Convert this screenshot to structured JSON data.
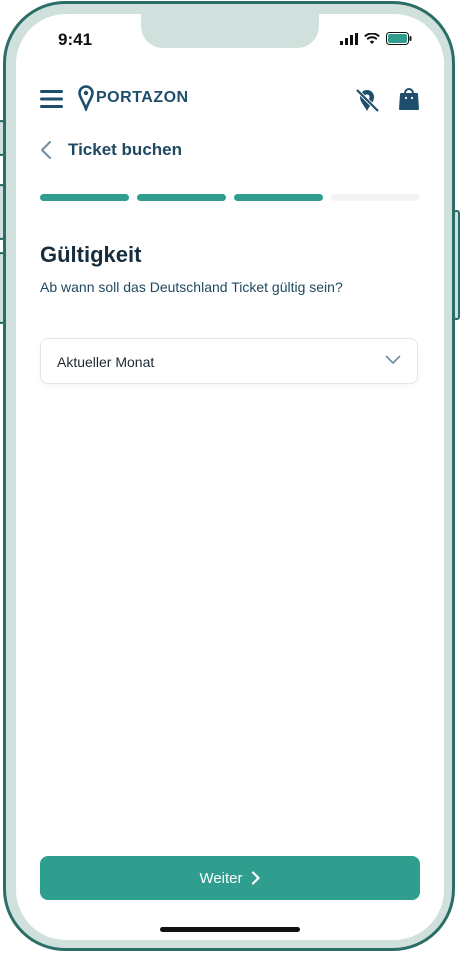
{
  "status_bar": {
    "time": "9:41"
  },
  "header": {
    "logo_text": "PORTAZON"
  },
  "nav": {
    "title": "Ticket buchen"
  },
  "progress": {
    "total_steps": 4,
    "completed_steps": 3,
    "accent": "#2f9e8f"
  },
  "content": {
    "heading": "Gültigkeit",
    "subtitle": "Ab wann soll das Deutschland Ticket gültig sein?",
    "select": {
      "value": "Aktueller Monat"
    }
  },
  "footer": {
    "cta_label": "Weiter"
  },
  "colors": {
    "primary": "#2f9e8f",
    "navy": "#1e4e6b",
    "frame": "#cfe0dd"
  }
}
